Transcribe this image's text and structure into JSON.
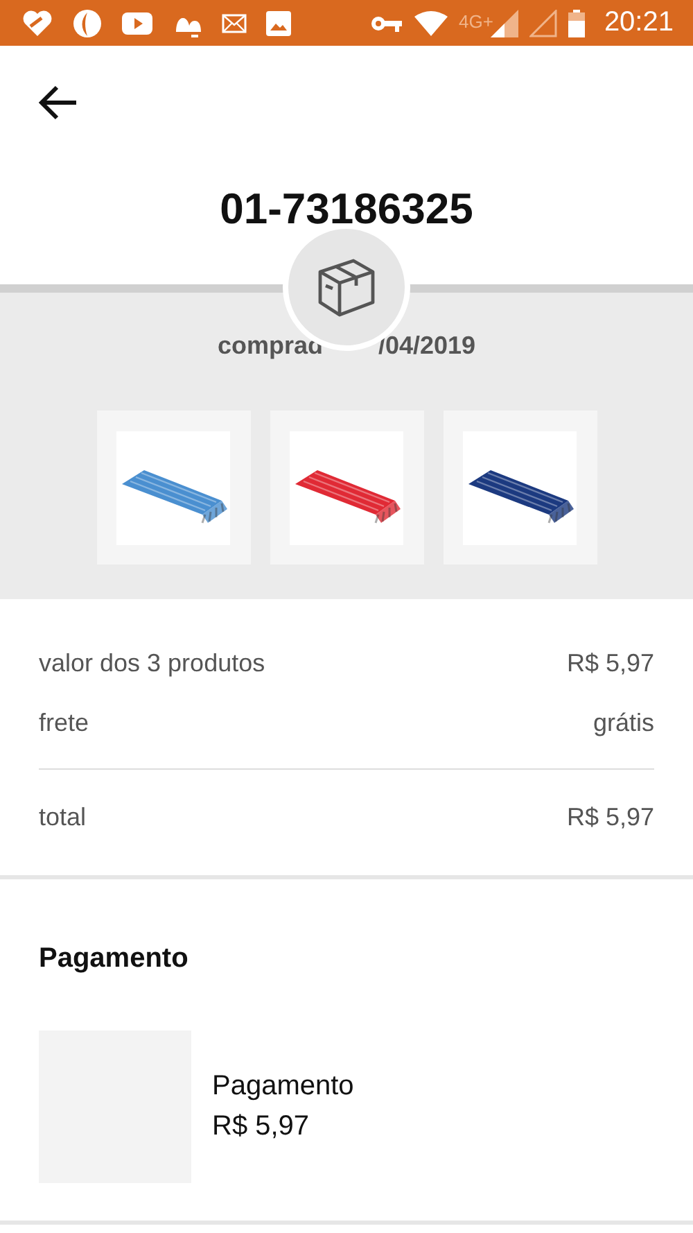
{
  "status_bar": {
    "network": "4G+",
    "time": "20:21"
  },
  "header": {
    "title": "01-73186325"
  },
  "order": {
    "date_before": "comprad",
    "date_after": "/04/2019"
  },
  "summary": [
    {
      "label": "valor dos 3 produtos",
      "value": "R$ 5,97"
    },
    {
      "label": "frete",
      "value": "grátis"
    },
    {
      "label": "total",
      "value": "R$ 5,97"
    }
  ],
  "payment": {
    "heading": "Pagamento",
    "name": "Pagamento",
    "amount": "R$ 5,97"
  }
}
